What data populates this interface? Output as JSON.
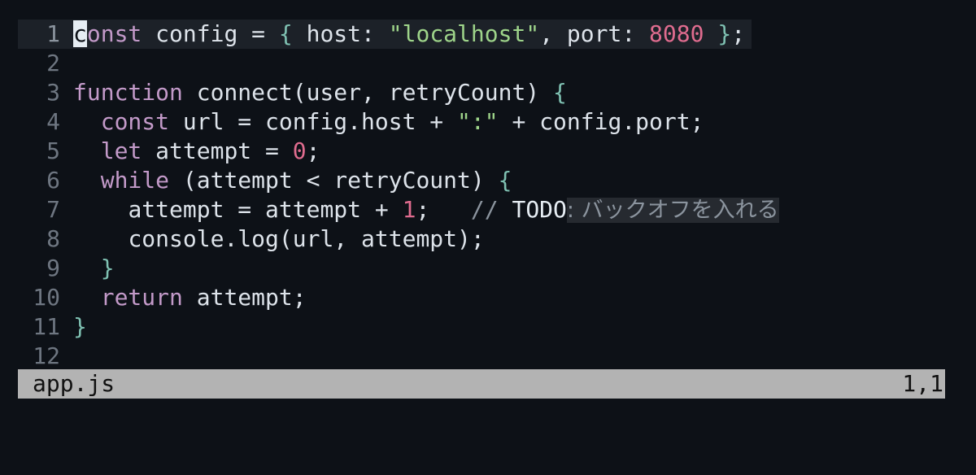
{
  "editor": {
    "file_name": "app.js",
    "cursor_position": "1,1",
    "lines": [
      {
        "number": "1",
        "t1": "c",
        "t2": "onst",
        "t3": " config = ",
        "t4": "{",
        "t5": " host: ",
        "t6": "\"localhost\"",
        "t7": ", port: ",
        "t8": "8080",
        "t9": " ",
        "t10": "}",
        "t11": ";"
      },
      {
        "number": "2"
      },
      {
        "number": "3",
        "t1": "function",
        "t2": " connect(user, retryCount) ",
        "t3": "{"
      },
      {
        "number": "4",
        "t0": "  ",
        "t1": "const",
        "t2": " url = config.host + ",
        "t3": "\":\"",
        "t4": " + config.port;"
      },
      {
        "number": "5",
        "t0": "  ",
        "t1": "let",
        "t2": " attempt = ",
        "t3": "0",
        "t4": ";"
      },
      {
        "number": "6",
        "t0": "  ",
        "t1": "while",
        "t2": " (attempt < retryCount) ",
        "t3": "{"
      },
      {
        "number": "7",
        "t0": "    ",
        "t1": "attempt = attempt + ",
        "t2": "1",
        "t3": ";   ",
        "t4": "// ",
        "t5": "TODO",
        "t6": ": バックオフを入れる"
      },
      {
        "number": "8",
        "t0": "    ",
        "t1": "console.log(url, attempt);"
      },
      {
        "number": "9",
        "t0": "  ",
        "t1": "}"
      },
      {
        "number": "10",
        "t0": "  ",
        "t1": "return",
        "t2": " attempt;"
      },
      {
        "number": "11",
        "t1": "}"
      },
      {
        "number": "12"
      }
    ]
  },
  "colors": {
    "background": "#0d1117",
    "keyword": "#c39ac9",
    "string": "#9ed48a",
    "number": "#e06c8f",
    "punctuation": "#7fc1b2",
    "comment": "#8b949e",
    "statusline": "#b3b3b3"
  }
}
